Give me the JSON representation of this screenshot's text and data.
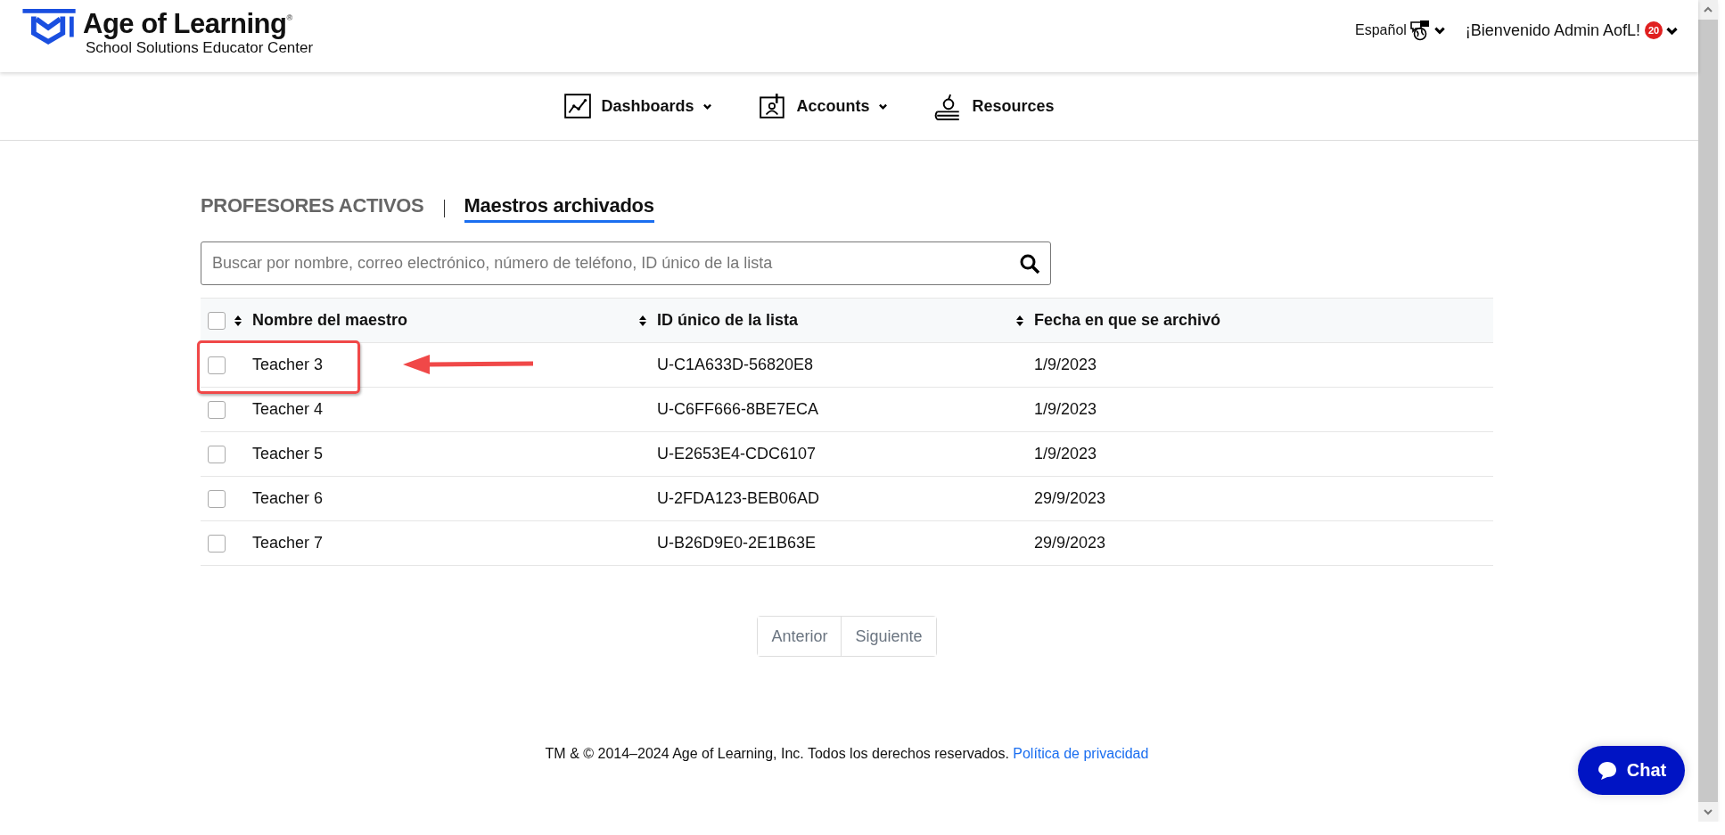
{
  "header": {
    "brand": "Age of Learning",
    "registered_mark": "®",
    "subtitle": "School Solutions Educator Center",
    "language": "Español",
    "welcome": "¡Bienvenido Admin AofL!",
    "notification_count": "20"
  },
  "nav": [
    {
      "label": "Dashboards",
      "dropdown": true
    },
    {
      "label": "Accounts",
      "dropdown": true
    },
    {
      "label": "Resources",
      "dropdown": false
    }
  ],
  "tabs": [
    {
      "label": "PROFESORES ACTIVOS",
      "selected": false
    },
    {
      "label": "Maestros archivados",
      "selected": true
    }
  ],
  "search": {
    "placeholder": "Buscar por nombre, correo electrónico, número de teléfono, ID único de la lista"
  },
  "table": {
    "select_all_checked": false,
    "columns": [
      "Nombre del maestro",
      "ID único de la lista",
      "Fecha en que se archivó"
    ],
    "rows": [
      {
        "checked": false,
        "highlighted": true,
        "cells": [
          "Teacher 3",
          "U-C1A633D-56820E8",
          "1/9/2023"
        ]
      },
      {
        "checked": false,
        "highlighted": false,
        "cells": [
          "Teacher 4",
          "U-C6FF666-8BE7ECA",
          "1/9/2023"
        ]
      },
      {
        "checked": false,
        "highlighted": false,
        "cells": [
          "Teacher 5",
          "U-E2653E4-CDC6107",
          "1/9/2023"
        ]
      },
      {
        "checked": false,
        "highlighted": false,
        "cells": [
          "Teacher 6",
          "U-2FDA123-BEB06AD",
          "29/9/2023"
        ]
      },
      {
        "checked": false,
        "highlighted": false,
        "cells": [
          "Teacher 7",
          "U-B26D9E0-2E1B63E",
          "29/9/2023"
        ]
      }
    ]
  },
  "pagination": [
    "Anterior",
    "Siguiente"
  ],
  "footer": {
    "text": "TM & © 2014–2024 Age of Learning, Inc. Todos los derechos reservados.",
    "link": "Política de privacidad"
  },
  "chat_button": "Chat"
}
